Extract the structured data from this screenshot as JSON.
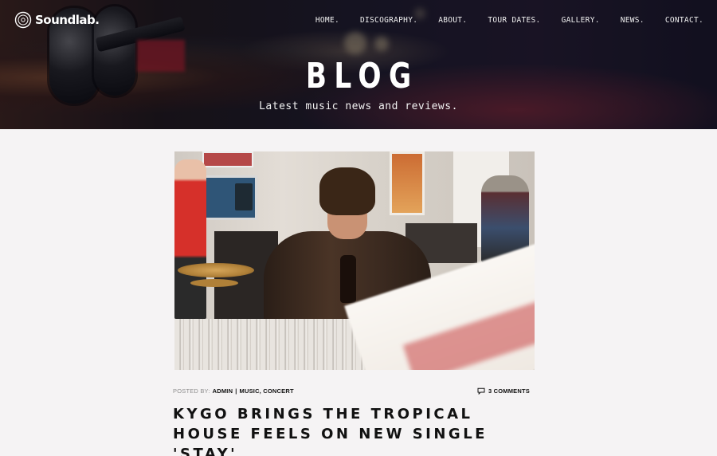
{
  "brand": {
    "name": "Soundlab.",
    "icon": "vinyl-record-icon"
  },
  "nav": {
    "items": [
      {
        "label": "HOME."
      },
      {
        "label": "DISCOGRAPHY."
      },
      {
        "label": "ABOUT."
      },
      {
        "label": "TOUR DATES."
      },
      {
        "label": "GALLERY."
      },
      {
        "label": "NEWS."
      },
      {
        "label": "CONTACT."
      }
    ]
  },
  "hero": {
    "title": "BLOG",
    "subtitle": "Latest music news and reviews."
  },
  "post": {
    "meta": {
      "posted_by_label": "POSTED BY:",
      "author": "ADMIN",
      "separator": "|",
      "categories": "MUSIC, CONCERT",
      "comments": "3 COMMENTS",
      "comments_icon": "speech-bubble-icon"
    },
    "title": "KYGO BRINGS THE TROPICAL HOUSE FEELS ON NEW SINGLE 'STAY'"
  },
  "colors": {
    "page_bg": "#f5f3f4",
    "text": "#111111",
    "muted": "#8e8e8e",
    "hero_overlay": "#1a1626"
  }
}
